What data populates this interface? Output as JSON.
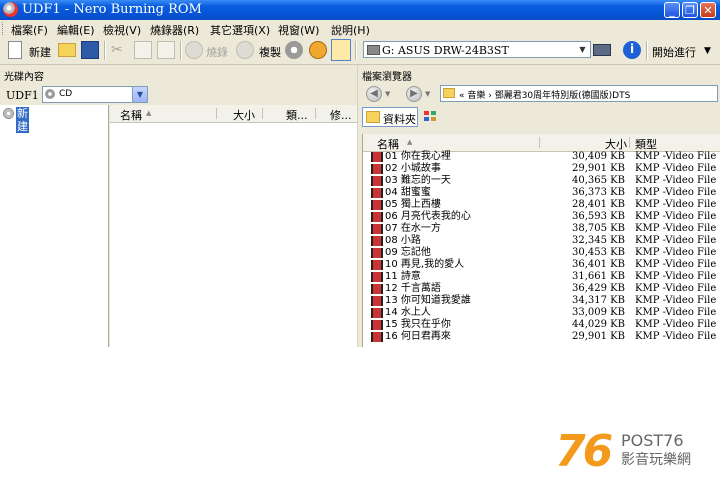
{
  "window": {
    "title": "UDF1 - Nero Burning ROM"
  },
  "menu": [
    "檔案(F)",
    "編輯(E)",
    "檢視(V)",
    "燒錄器(R)",
    "其它選項(X)",
    "視窗(W)",
    "說明(H)"
  ],
  "toolbar": {
    "new_label": "新建",
    "burn_label": "燒錄",
    "copy_label": "複製",
    "drive": "G: ASUS DRW-24B3ST",
    "start_label": "開始進行"
  },
  "left": {
    "header": "光碟內容",
    "disc_label": "UDF1",
    "disc_type": "CD",
    "tree_item": "新建",
    "columns": [
      "名稱",
      "大小",
      "類...",
      "修..."
    ]
  },
  "right": {
    "header": "檔案瀏覽器",
    "path": "« 音樂 › 鄧麗君30周年特別版(德國版)DTS",
    "folders_label": "資料夾",
    "columns": [
      "名稱",
      "大小",
      "類型"
    ],
    "files": [
      {
        "name": "01 你在我心裡",
        "size": "30,409 KB",
        "type": "KMP -Video File"
      },
      {
        "name": "02 小城故事",
        "size": "29,901 KB",
        "type": "KMP -Video File"
      },
      {
        "name": "03 難忘的一天",
        "size": "40,365 KB",
        "type": "KMP -Video File"
      },
      {
        "name": "04 甜蜜蜜",
        "size": "36,373 KB",
        "type": "KMP -Video File"
      },
      {
        "name": "05 獨上西樓",
        "size": "28,401 KB",
        "type": "KMP -Video File"
      },
      {
        "name": "06 月亮代表我的心",
        "size": "36,593 KB",
        "type": "KMP -Video File"
      },
      {
        "name": "07 在水一方",
        "size": "38,705 KB",
        "type": "KMP -Video File"
      },
      {
        "name": "08 小路",
        "size": "32,345 KB",
        "type": "KMP -Video File"
      },
      {
        "name": "09 忘記他",
        "size": "30,453 KB",
        "type": "KMP -Video File"
      },
      {
        "name": "10 再見,我的愛人",
        "size": "36,401 KB",
        "type": "KMP -Video File"
      },
      {
        "name": "11 詩意",
        "size": "31,661 KB",
        "type": "KMP -Video File"
      },
      {
        "name": "12 千言萬語",
        "size": "36,429 KB",
        "type": "KMP -Video File"
      },
      {
        "name": "13 你可知道我愛誰",
        "size": "34,317 KB",
        "type": "KMP -Video File"
      },
      {
        "name": "14 水上人",
        "size": "33,009 KB",
        "type": "KMP -Video File"
      },
      {
        "name": "15 我只在乎你",
        "size": "44,029 KB",
        "type": "KMP -Video File"
      },
      {
        "name": "16 何日君再來",
        "size": "29,901 KB",
        "type": "KMP -Video File"
      }
    ]
  },
  "watermark": {
    "number": "76",
    "brand": "POST76",
    "tagline": "影音玩樂網"
  },
  "colors": {
    "title_bar": "#0554d5",
    "selection": "#316ac5",
    "watermark_orange": "#f39a1c"
  }
}
